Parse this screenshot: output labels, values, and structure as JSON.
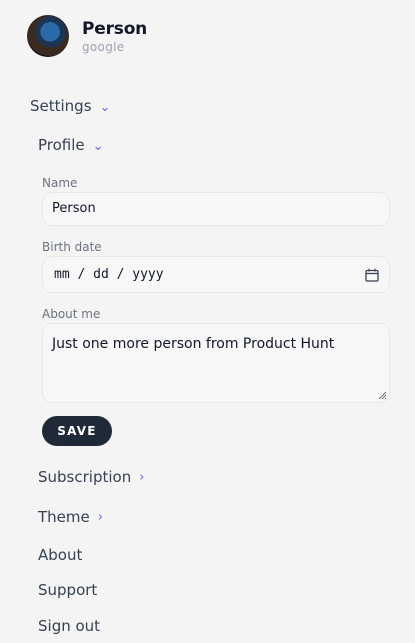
{
  "user": {
    "name": "Person",
    "provider": "google"
  },
  "menu": {
    "settings": "Settings",
    "profile": "Profile",
    "subscription": "Subscription",
    "theme": "Theme",
    "about": "About",
    "support": "Support",
    "sign_out": "Sign out"
  },
  "profile_form": {
    "name_label": "Name",
    "name_value": "Person",
    "birth_label": "Birth date",
    "birth_placeholder": "mm / dd / yyyy",
    "about_label": "About me",
    "about_value": "Just one more person from Product Hunt",
    "save_label": "SAVE"
  },
  "icons": {
    "expanded": "chevron-down-icon",
    "collapsed": "chevron-right-icon",
    "date": "calendar-icon"
  },
  "colors": {
    "accent": "#6366f1",
    "button": "#1f2937",
    "background": "#f4f4f5"
  }
}
